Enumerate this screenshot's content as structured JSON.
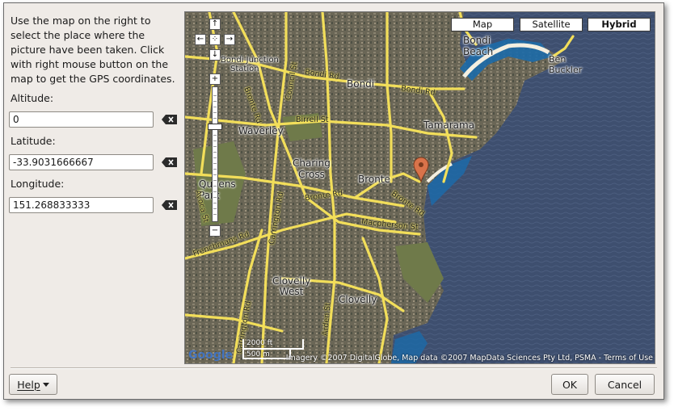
{
  "intro": {
    "lines": [
      "Use the map on the right to",
      "select the place where the",
      "picture have been taken. Click",
      "with right mouse button on the",
      "map to get the GPS coordinates."
    ]
  },
  "fields": {
    "altitude": {
      "label": "Altitude:",
      "value": "0"
    },
    "latitude": {
      "label": "Latitude:",
      "value": "-33.9031666667"
    },
    "longitude": {
      "label": "Longitude:",
      "value": "151.268833333"
    }
  },
  "map": {
    "map_types": [
      "Map",
      "Satellite",
      "Hybrid"
    ],
    "active_map_type": "Hybrid",
    "nav": {
      "up": "↑",
      "left": "←",
      "center": "⁘",
      "right": "→",
      "down": "↓",
      "zoom_in": "+",
      "zoom_out": "−"
    },
    "labels": {
      "bondi_junction": "Bondi Junction",
      "station": "Station",
      "bondi_beach": "Bondi\nBeach",
      "ben_buckler": "Ben\nBuckler",
      "bondi": "Bondi",
      "waverley": "Waverley",
      "tamarama": "Tamarama",
      "charing_cross": "Charing\nCross",
      "bronte": "Bronte",
      "queens_park": "Queens\nPark",
      "clovelly_west": "Clovelly\nWest",
      "clovelly": "Clovelly"
    },
    "roads": {
      "bondi_rd_1": "Bondi Rd",
      "bondi_rd_2": "Bondi Rd",
      "birrell_st": "Birrell St",
      "council_st": "Council St",
      "bronte_rd_1": "Bronte Rd",
      "bronte_rd_2": "Bronte Rd",
      "bronte_rd_3": "Bronte Rd",
      "macpherson_st": "Macpherson St",
      "frenchmans_rd": "Frenchmans Rd",
      "carrington_rd_1": "Carrington Rd",
      "carrington_rd_2": "Carrington Rd",
      "arden_st": "Arden St",
      "avoca": "Avoca St"
    },
    "scale": {
      "ft": "2000 ft",
      "m": "500 m"
    },
    "logo": "Google",
    "copyright": "Imagery ©2007 DigitalGlobe, Map data ©2007 MapData Sciences Pty Ltd, PSMA - Terms of Use",
    "colors": {
      "land": "#5b5a4f",
      "road": "#f2de5a",
      "ocean": "#3c4d6e",
      "water_shallow": "#1e6aa8",
      "marker": "#d9734a"
    }
  },
  "buttons": {
    "help": "Help",
    "ok": "OK",
    "cancel": "Cancel"
  }
}
